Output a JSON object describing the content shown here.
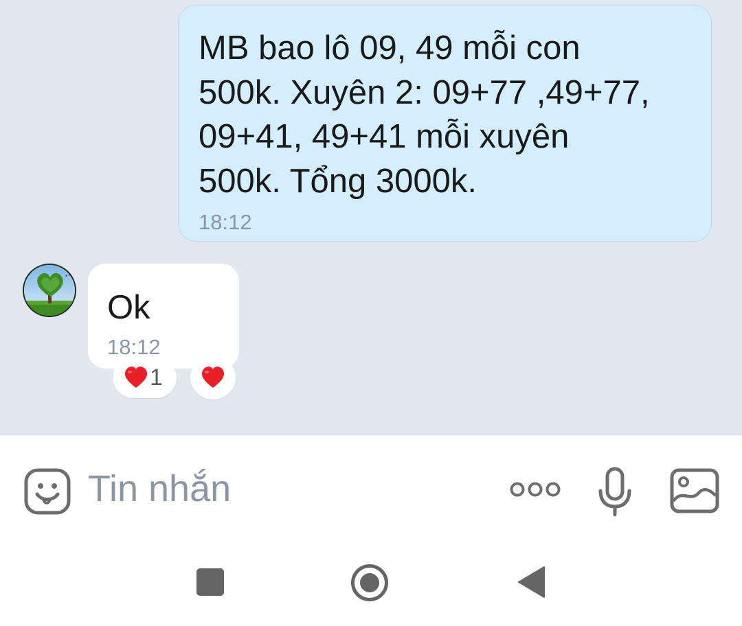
{
  "messages": {
    "outgoing": {
      "text": "MB bao lô 09, 49 mỗi con\n500k. Xuyên 2: 09+77 ,49+77,\n09+41, 49+41 mỗi xuyên\n500k. Tổng 3000k.",
      "time": "18:12"
    },
    "incoming": {
      "text": "Ok",
      "time": "18:12",
      "reactions": {
        "heart_count": "1"
      }
    }
  },
  "composer": {
    "placeholder": "Tin nhắn"
  },
  "colors": {
    "chat_background": "#e3e8f0",
    "outgoing_bubble": "#d5eefe",
    "incoming_bubble": "#ffffff",
    "timestamp": "#8a96a3",
    "heart": "#e8202a",
    "icon": "#6e6e6e"
  },
  "icons": {
    "composer": [
      "smiley-icon",
      "more-dots-icon",
      "microphone-icon",
      "image-icon"
    ],
    "navigation": [
      "recent-apps-icon",
      "home-icon",
      "back-icon"
    ],
    "reactions": [
      "heart-icon"
    ]
  }
}
